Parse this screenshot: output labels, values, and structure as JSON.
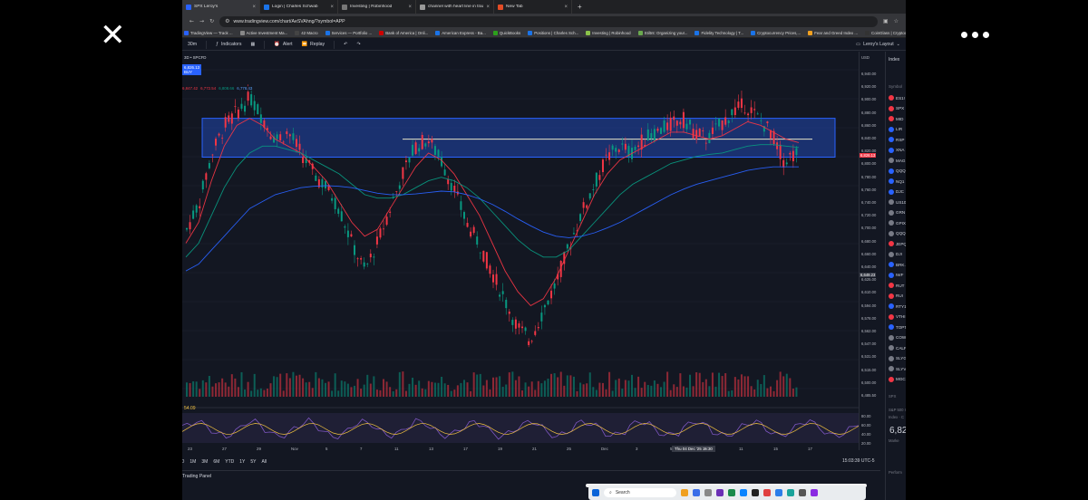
{
  "viewer": {
    "close_icon": "close-icon",
    "more_icon": "more-dots-icon"
  },
  "browser": {
    "tabs": [
      {
        "label": "SPX Leroy's",
        "color": "#2962ff",
        "active": true
      },
      {
        "label": "Login | Charles Schwab",
        "color": "#1a73e8"
      },
      {
        "label": "Investing | Robinhood",
        "color": "#777"
      },
      {
        "label": "channel with heart line in tradin",
        "color": "#999"
      },
      {
        "label": "New Tab",
        "color": "#e34c26"
      }
    ],
    "url": "www.tradingview.com/chart/AeSVAhng/?symbol=APP",
    "bookmarks": [
      "TradingView — Track ...",
      "Active Investment Ma...",
      "42 Macro",
      "Services — Portfolio ...",
      "Bank of America | Onli...",
      "American Express - Ba...",
      "QuickBooks",
      "Positions | Charles Sch...",
      "Investing | Robinhood",
      "Stiltnt: Organizing your...",
      "Fidelity Technology | T...",
      "Cryptocurrency Prices,...",
      "Fear and Greed Index ...",
      "CoinGlass | Cryptocurr..."
    ]
  },
  "toolbar": {
    "interval": "30m",
    "indicators": "Indicators",
    "alert": "Alert",
    "replay": "Replay",
    "layout": "Leroy's Layout"
  },
  "chart": {
    "symbol_legend": "3D • SPCFD",
    "mini_price": "6,826.13",
    "mini_sub": "BUY",
    "ma_legend": [
      "6,847.42",
      "6,772.54",
      "6,808.66",
      "6,778.43"
    ],
    "rsi_value": "54.09",
    "currency": "USD"
  },
  "chart_data": {
    "type": "line",
    "title": "",
    "xlabel": "",
    "ylabel": "",
    "ylim": [
      6480,
      6950
    ],
    "x_ticks": [
      "23",
      "27",
      "29",
      "Nov",
      "5",
      "7",
      "11",
      "13",
      "17",
      "19",
      "21",
      "25",
      "Dec",
      "3",
      "5",
      "9",
      "11",
      "15",
      "17"
    ],
    "y_ticks": [
      "6,940.00",
      "6,920.00",
      "6,900.00",
      "6,880.00",
      "6,860.00",
      "6,840.00",
      "6,820.00",
      "6,800.00",
      "6,780.00",
      "6,760.00",
      "6,740.00",
      "6,720.00",
      "6,700.00",
      "6,680.00",
      "6,660.00",
      "6,640.00",
      "6,625.00",
      "6,610.00",
      "6,594.00",
      "6,578.00",
      "6,562.00",
      "6,547.00",
      "6,531.00",
      "6,515.00",
      "6,500.00",
      "6,485.50"
    ],
    "price_tag": "6,826.13",
    "price_tag_label": "SPX",
    "crosshair_price": "6,649.23",
    "crosshair_date": "Thu 04 Dec '25  15:30",
    "channel": {
      "top": 6880,
      "bottom": 6824
    },
    "heart_line": 6850,
    "series": [
      {
        "name": "",
        "color": "#d1d4dc",
        "values": [
          6720,
          6760,
          6830,
          6870,
          6890,
          6910,
          6880,
          6850,
          6860,
          6830,
          6800,
          6780,
          6750,
          6700,
          6660,
          6700,
          6750,
          6800,
          6840,
          6850,
          6820,
          6780,
          6730,
          6700,
          6660,
          6620,
          6580,
          6560,
          6600,
          6640,
          6690,
          6740,
          6780,
          6820,
          6840,
          6830,
          6850,
          6860,
          6870,
          6880,
          6860,
          6850,
          6870,
          6890,
          6900,
          6880,
          6860,
          6820,
          6830
        ]
      },
      {
        "name": "",
        "color": "#f23645",
        "values": [
          6700,
          6730,
          6790,
          6840,
          6870,
          6880,
          6870,
          6850,
          6840,
          6830,
          6810,
          6790,
          6760,
          6730,
          6710,
          6720,
          6750,
          6780,
          6810,
          6830,
          6820,
          6800,
          6770,
          6740,
          6700,
          6660,
          6630,
          6610,
          6620,
          6650,
          6690,
          6730,
          6770,
          6800,
          6820,
          6830,
          6840,
          6850,
          6860,
          6860,
          6855,
          6850,
          6855,
          6865,
          6875,
          6870,
          6860,
          6850,
          6845
        ]
      },
      {
        "name": "",
        "color": "#089981",
        "values": [
          6680,
          6700,
          6740,
          6780,
          6810,
          6830,
          6840,
          6840,
          6835,
          6830,
          6820,
          6810,
          6800,
          6785,
          6770,
          6765,
          6765,
          6770,
          6780,
          6790,
          6795,
          6790,
          6780,
          6765,
          6745,
          6725,
          6705,
          6690,
          6680,
          6680,
          6690,
          6710,
          6730,
          6750,
          6770,
          6785,
          6795,
          6805,
          6815,
          6820,
          6825,
          6828,
          6830,
          6835,
          6840,
          6842,
          6842,
          6840,
          6838
        ]
      },
      {
        "name": "",
        "color": "#2962ff",
        "values": [
          6660,
          6670,
          6690,
          6710,
          6730,
          6750,
          6760,
          6770,
          6775,
          6780,
          6782,
          6783,
          6782,
          6780,
          6776,
          6772,
          6770,
          6770,
          6771,
          6773,
          6775,
          6774,
          6770,
          6764,
          6756,
          6746,
          6735,
          6725,
          6716,
          6710,
          6708,
          6710,
          6715,
          6722,
          6730,
          6740,
          6750,
          6760,
          6770,
          6778,
          6785,
          6790,
          6795,
          6800,
          6805,
          6808,
          6810,
          6810,
          6810
        ]
      }
    ],
    "rsi": {
      "levels": [
        "80.00",
        "60.00",
        "40.00",
        "20.00"
      ],
      "ylim": [
        0,
        100
      ]
    }
  },
  "bottom": {
    "ranges": [
      "5D",
      "1M",
      "3M",
      "6M",
      "YTD",
      "1Y",
      "5Y",
      "All"
    ],
    "clock": "15:03:39 UTC-5",
    "panel": "Trading Panel"
  },
  "watchlist": {
    "header": "Index",
    "symbol_col": "Symbol",
    "items": [
      {
        "label": "ES1!",
        "color": "#f23645"
      },
      {
        "label": "SPX",
        "color": "#f23645"
      },
      {
        "label": "MID",
        "color": "#f23645"
      },
      {
        "label": "LIR",
        "color": "#2962ff"
      },
      {
        "label": "RSP",
        "color": "#2962ff"
      },
      {
        "label": "XNA",
        "color": "#2962ff"
      },
      {
        "label": "MAG",
        "color": "#787b86"
      },
      {
        "label": "QQQ",
        "color": "#2962ff"
      },
      {
        "label": "NQ1",
        "color": "#2962ff"
      },
      {
        "label": "DJC",
        "color": "#2962ff"
      },
      {
        "label": "US10",
        "color": "#787b86"
      },
      {
        "label": "GRN",
        "color": "#787b86"
      },
      {
        "label": "GPIX",
        "color": "#787b86"
      },
      {
        "label": "QQQ",
        "color": "#787b86"
      },
      {
        "label": "JEPQ",
        "color": "#f23645"
      },
      {
        "label": "DJI",
        "color": "#787b86"
      },
      {
        "label": "BRK.",
        "color": "#2962ff"
      },
      {
        "label": "IWF",
        "color": "#2962ff"
      },
      {
        "label": "RUT",
        "color": "#f23645"
      },
      {
        "label": "RUI",
        "color": "#f23645"
      },
      {
        "label": "RTY1",
        "color": "#2962ff"
      },
      {
        "label": "VTHI",
        "color": "#f23645"
      },
      {
        "label": "TOPT",
        "color": "#2962ff"
      },
      {
        "label": "COW",
        "color": "#787b86"
      },
      {
        "label": "CALF",
        "color": "#787b86"
      },
      {
        "label": "SLYG",
        "color": "#787b86"
      },
      {
        "label": "SLYV",
        "color": "#787b86"
      },
      {
        "label": "MGC",
        "color": "#f23645"
      }
    ],
    "detail_symbol": "SPX",
    "detail_name": "S&P 500 I",
    "detail_type": "Index · C",
    "detail_price": "6,82",
    "detail_status": "Marke",
    "detail_perf": "Perform"
  },
  "taskbar": {
    "search": "Search"
  }
}
